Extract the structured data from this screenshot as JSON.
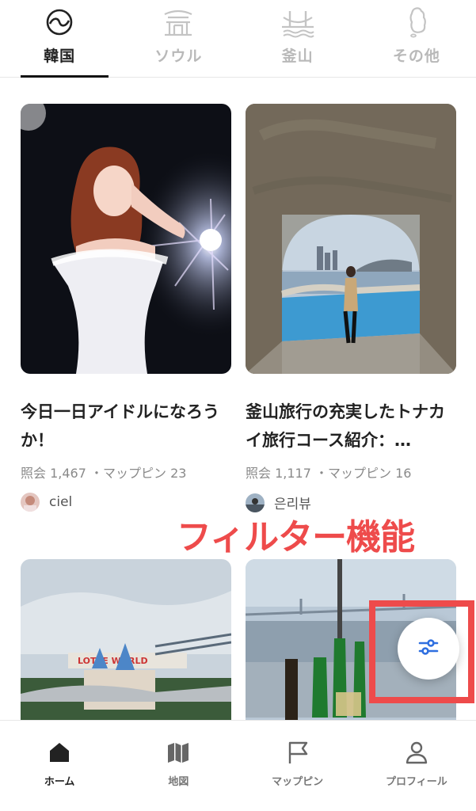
{
  "region_tabs": [
    {
      "label": "韓国",
      "icon": "korea-circle-icon",
      "active": true
    },
    {
      "label": "ソウル",
      "icon": "palace-gate-icon",
      "active": false
    },
    {
      "label": "釜山",
      "icon": "bridge-icon",
      "active": false
    },
    {
      "label": "その他",
      "icon": "korea-map-icon",
      "active": false
    }
  ],
  "posts": [
    {
      "title": "今日一日アイドルになろうか！",
      "meta": "照会 1,467 ・マップピン 23",
      "author": "ciel"
    },
    {
      "title": "釜山旅行の充実したトナカイ旅行コース紹介：…",
      "meta": "照会 1,117 ・マップピン 16",
      "author": "은리뷰"
    }
  ],
  "annotation": {
    "text": "フィルター機能",
    "color": "#ee4b4b"
  },
  "fab": {
    "icon": "filter-sliders-icon",
    "color": "#2f6fe0"
  },
  "bottom_nav": [
    {
      "label": "ホーム",
      "icon": "home-icon",
      "active": true
    },
    {
      "label": "地図",
      "icon": "map-icon",
      "active": false
    },
    {
      "label": "マップピン",
      "icon": "flag-icon",
      "active": false
    },
    {
      "label": "プロフィール",
      "icon": "person-icon",
      "active": false
    }
  ]
}
